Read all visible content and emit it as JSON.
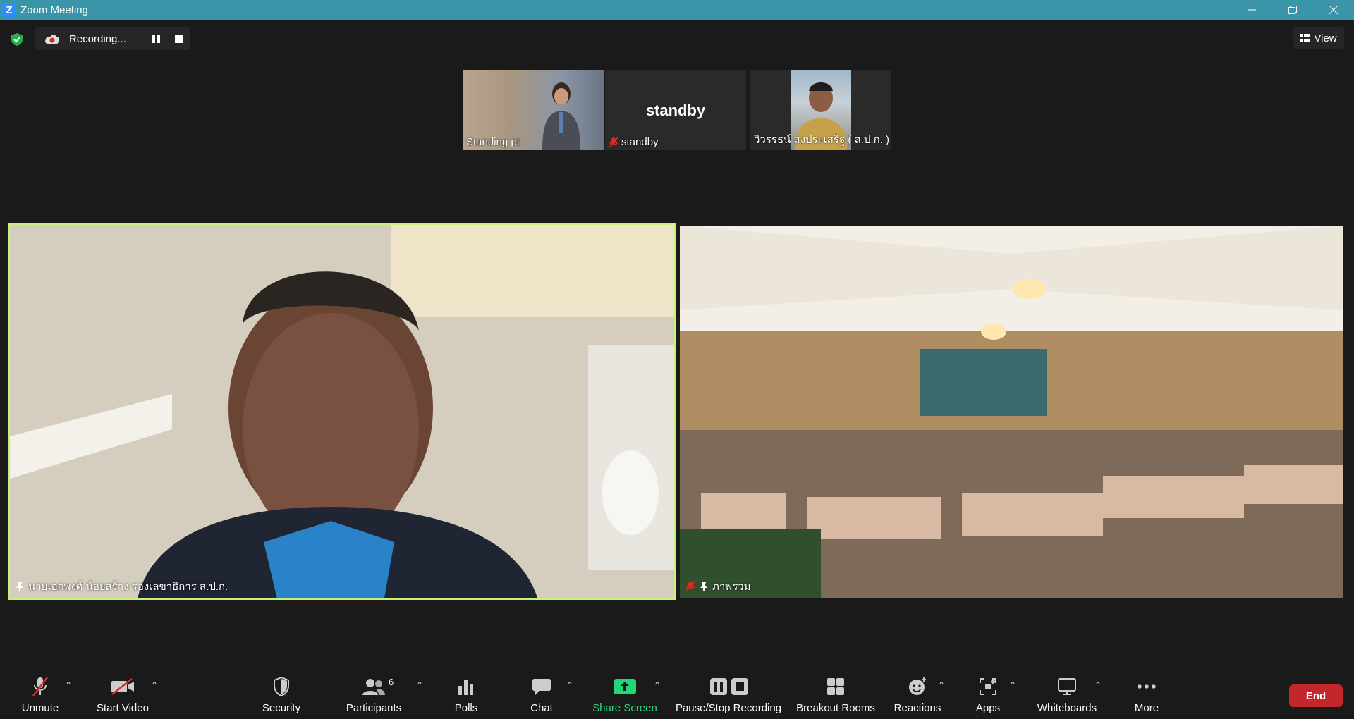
{
  "window": {
    "title": "Zoom Meeting",
    "app_logo": "Z"
  },
  "recording": {
    "status": "Recording..."
  },
  "view_button": {
    "label": "View"
  },
  "thumbnails": [
    {
      "name": "Standing pt",
      "muted": false
    },
    {
      "name": "standby",
      "display_text": "standby",
      "muted": true
    },
    {
      "name": "วิวรรธน์ สงประเสริฐ ( ส.ป.ก. )",
      "muted": false
    }
  ],
  "main_videos": [
    {
      "name": "นายเอกพงศ์ น้อยสร้าง รองเลขาธิการ ส.ป.ก.",
      "pinned": true,
      "muted": false,
      "active_speaker": true
    },
    {
      "name": "ภาพรวม",
      "pinned": true,
      "muted": true,
      "active_speaker": false
    }
  ],
  "toolbar": {
    "unmute": "Unmute",
    "start_video": "Start Video",
    "security": "Security",
    "participants": "Participants",
    "participants_count": "6",
    "polls": "Polls",
    "chat": "Chat",
    "share_screen": "Share Screen",
    "pause_stop_recording": "Pause/Stop Recording",
    "breakout_rooms": "Breakout Rooms",
    "reactions": "Reactions",
    "apps": "Apps",
    "whiteboards": "Whiteboards",
    "more": "More",
    "end": "End"
  },
  "colors": {
    "titlebar": "#3b95a8",
    "active_speaker_border": "#c9f07a",
    "share_screen_green": "#24d67a",
    "end_red": "#c4262b",
    "background": "#1a1a1a"
  }
}
